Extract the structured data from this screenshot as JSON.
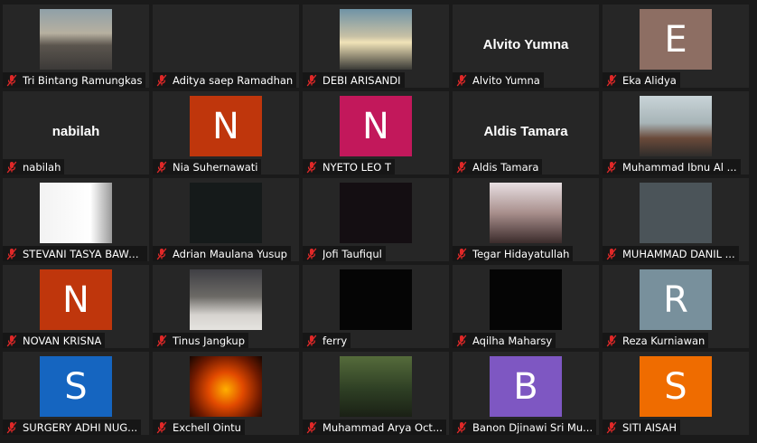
{
  "colors": {
    "background": "#1a1a1a",
    "tile": "#262626",
    "label_bg": "#141414",
    "text": "#ffffff",
    "mic_muted": "#e02828"
  },
  "participants": [
    {
      "name": "Tri Bintang Ramungkas",
      "media": "photo",
      "photo": "city-street-photo"
    },
    {
      "name": "Aditya saep Ramadhan",
      "media": "video-off"
    },
    {
      "name": "DEBI ARISANDI",
      "media": "photo",
      "photo": "sunset-photo"
    },
    {
      "name": "Alvito Yumna",
      "media": "name",
      "display": "Alvito Yumna"
    },
    {
      "name": "Eka Alidya",
      "media": "avatar",
      "initial": "E",
      "color": "#8d6e63"
    },
    {
      "name": "nabilah",
      "media": "name",
      "display": "nabilah"
    },
    {
      "name": "Nia Suhernawati",
      "media": "avatar",
      "initial": "N",
      "color": "#bf360c"
    },
    {
      "name": "NYETO LEO T",
      "media": "avatar",
      "initial": "N",
      "color": "#c2185b"
    },
    {
      "name": "Aldis Tamara",
      "media": "name",
      "display": "Aldis Tamara"
    },
    {
      "name": "Muhammad Ibnu Al ...",
      "media": "photo",
      "photo": "pilot-photo"
    },
    {
      "name": "STEVANI TASYA BAWA...",
      "media": "photo",
      "photo": "white-photo"
    },
    {
      "name": "Adrian Maulana Yusup",
      "media": "photo",
      "photo": "dark-video-1"
    },
    {
      "name": "Jofi Taufiqul",
      "media": "photo",
      "photo": "dark-video-2"
    },
    {
      "name": "Tegar Hidayatullah",
      "media": "photo",
      "photo": "anime-photo"
    },
    {
      "name": "MUHAMMAD DANIL ...",
      "media": "photo",
      "photo": "grey-photo"
    },
    {
      "name": "NOVAN KRISNA",
      "media": "avatar",
      "initial": "N",
      "color": "#bf360c"
    },
    {
      "name": "Tinus Jangkup",
      "media": "photo",
      "photo": "tinus-photo"
    },
    {
      "name": "ferry",
      "media": "photo",
      "photo": "black-video"
    },
    {
      "name": "Aqilha Maharsy",
      "media": "photo",
      "photo": "black-video"
    },
    {
      "name": "Reza Kurniawan",
      "media": "avatar",
      "initial": "R",
      "color": "#78909c"
    },
    {
      "name": "SURGERY ADHI NUG...",
      "media": "avatar",
      "initial": "S",
      "color": "#1565c0"
    },
    {
      "name": "Exchell Ointu",
      "media": "photo",
      "photo": "fire-photo"
    },
    {
      "name": "Muhammad Arya Oct...",
      "media": "photo",
      "photo": "forest-photo"
    },
    {
      "name": "Banon Djinawi Sri Mu...",
      "media": "avatar",
      "initial": "B",
      "color": "#7e57c2"
    },
    {
      "name": "SITI AISAH",
      "media": "avatar",
      "initial": "S",
      "color": "#ef6c00"
    }
  ],
  "icons": {
    "mic": "mic-muted-icon"
  }
}
